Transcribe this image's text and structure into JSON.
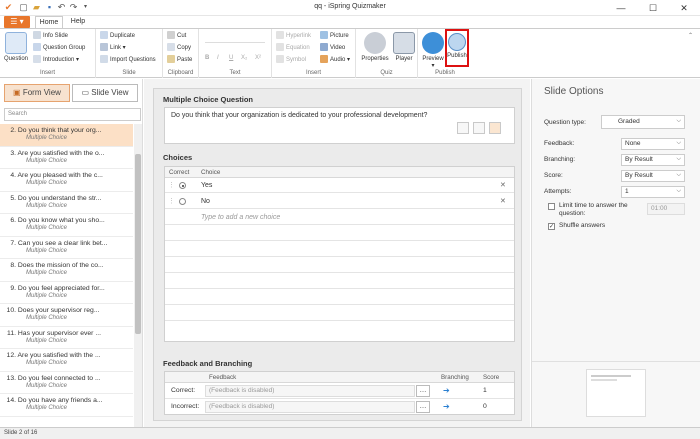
{
  "window": {
    "title": "qq - iSpring Quizmaker"
  },
  "tabs": [
    {
      "label": "Home"
    },
    {
      "label": "Help"
    }
  ],
  "ribbon": {
    "insert": {
      "group": "Insert",
      "question": "Question",
      "info_slide": "Info Slide",
      "question_group": "Question Group",
      "introduction": "Introduction"
    },
    "slide": {
      "group": "Slide",
      "duplicate": "Duplicate",
      "link": "Link",
      "import_questions": "Import Questions"
    },
    "clipboard": {
      "group": "Clipboard",
      "cut": "Cut",
      "copy": "Copy",
      "paste": "Paste"
    },
    "text": {
      "group": "Text",
      "bold": "B",
      "italic": "I",
      "underline": "U",
      "subscript": "X₂",
      "superscript": "X²"
    },
    "insert2": {
      "group": "Insert",
      "hyperlink": "Hyperlink",
      "equation": "Equation",
      "symbol": "Symbol",
      "picture": "Picture",
      "video": "Video",
      "audio": "Audio"
    },
    "quiz": {
      "group": "Quiz",
      "properties": "Properties",
      "player": "Player"
    },
    "publish": {
      "group": "Publish",
      "preview": "Preview",
      "publish": "Publish"
    }
  },
  "left": {
    "form_view": "Form View",
    "slide_view": "Slide View",
    "search_placeholder": "Search",
    "slides": [
      {
        "num": "2.",
        "title": "Do you think that your org...",
        "type": "Multiple Choice"
      },
      {
        "num": "3.",
        "title": "Are you satisfied with the o...",
        "type": "Multiple Choice"
      },
      {
        "num": "4.",
        "title": "Are you pleased with the c...",
        "type": "Multiple Choice"
      },
      {
        "num": "5.",
        "title": "Do you understand the str...",
        "type": "Multiple Choice"
      },
      {
        "num": "6.",
        "title": "Do you know what you sho...",
        "type": "Multiple Choice"
      },
      {
        "num": "7.",
        "title": "Can you see a clear link bet...",
        "type": "Multiple Choice"
      },
      {
        "num": "8.",
        "title": "Does the mission of the co...",
        "type": "Multiple Choice"
      },
      {
        "num": "9.",
        "title": "Do you feel appreciated for...",
        "type": "Multiple Choice"
      },
      {
        "num": "10.",
        "title": "Does your supervisor reg...",
        "type": "Multiple Choice"
      },
      {
        "num": "11.",
        "title": "Has your supervisor ever ...",
        "type": "Multiple Choice"
      },
      {
        "num": "12.",
        "title": "Are you satisfied with the ...",
        "type": "Multiple Choice"
      },
      {
        "num": "13.",
        "title": "Do you feel connected to ...",
        "type": "Multiple Choice"
      },
      {
        "num": "14.",
        "title": "Do you have any friends a...",
        "type": "Multiple Choice"
      }
    ]
  },
  "editor": {
    "heading": "Multiple Choice Question",
    "question": "Do you think that your organization is dedicated to your professional development?",
    "choices_heading": "Choices",
    "col_correct": "Correct",
    "col_choice": "Choice",
    "choices": [
      {
        "text": "Yes",
        "selected": true
      },
      {
        "text": "No",
        "selected": false
      }
    ],
    "new_choice_placeholder": "Type to add a new choice",
    "feedback_heading": "Feedback and Branching",
    "fb_col_feedback": "Feedback",
    "fb_col_branching": "Branching",
    "fb_col_score": "Score",
    "fb_rows": [
      {
        "label": "Correct:",
        "feedback": "(Feedback is disabled)",
        "score": "1"
      },
      {
        "label": "Incorrect:",
        "feedback": "(Feedback is disabled)",
        "score": "0"
      }
    ]
  },
  "options": {
    "title": "Slide Options",
    "question_type_label": "Question type:",
    "question_type": "Graded",
    "feedback_label": "Feedback:",
    "feedback": "None",
    "branching_label": "Branching:",
    "branching": "By Result",
    "score_label": "Score:",
    "score": "By Result",
    "attempts_label": "Attempts:",
    "attempts": "1",
    "limit_time_label": "Limit time to answer the question:",
    "limit_time_value": "01:00",
    "shuffle_label": "Shuffle answers"
  },
  "status": {
    "text": "Slide 2 of 16"
  },
  "colors": {
    "accent": "#e8762b",
    "selection": "#fce0c6",
    "link": "#2a7fd1"
  }
}
